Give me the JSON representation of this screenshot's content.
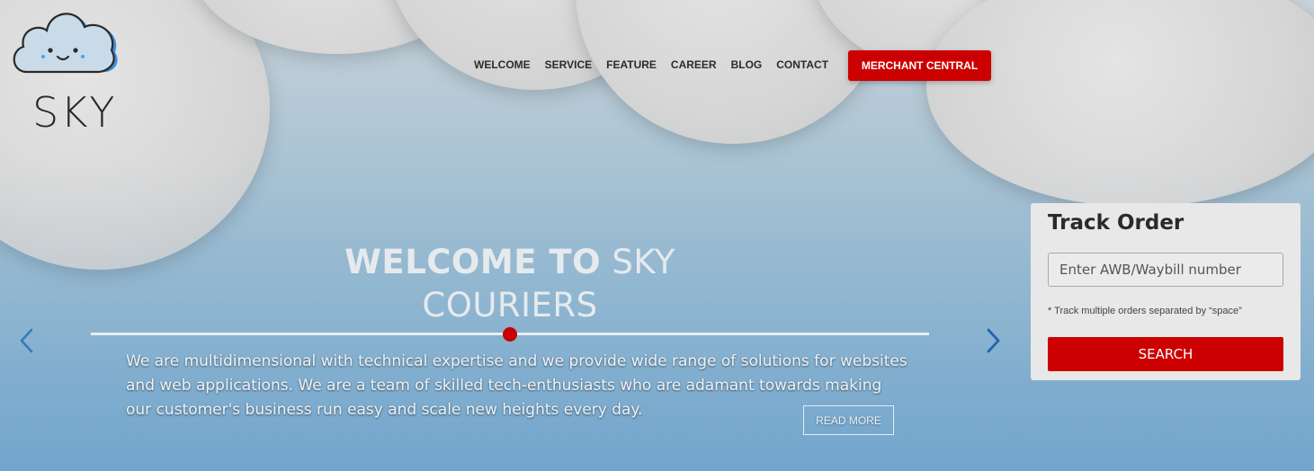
{
  "brand": {
    "name": "SKY"
  },
  "nav": {
    "items": [
      {
        "label": "WELCOME"
      },
      {
        "label": "SERVICE"
      },
      {
        "label": "FEATURE"
      },
      {
        "label": "CAREER"
      },
      {
        "label": "BLOG"
      },
      {
        "label": "CONTACT"
      }
    ],
    "merchant_button": "MERCHANT CENTRAL"
  },
  "hero": {
    "title_bold": "WELCOME TO",
    "title_light": "SKY COURIERS",
    "description": "We are multidimensional with technical expertise and we provide wide range of solutions for websites and web applications. We are a team of skilled tech-enthusiasts who are adamant towards making our customer's business run easy and scale new heights every day.",
    "read_more": "READ MORE"
  },
  "slider": {
    "prev_icon": "chevron-left-icon",
    "next_icon": "chevron-right-icon"
  },
  "track_order": {
    "title": "Track Order",
    "placeholder": "Enter AWB/Waybill number",
    "value": "",
    "note": "* Track multiple orders separated by “space”",
    "button": "SEARCH"
  },
  "colors": {
    "accent": "#cc0000",
    "text_dark": "#2a2a2a",
    "panel_bg": "#e8e8e8"
  }
}
